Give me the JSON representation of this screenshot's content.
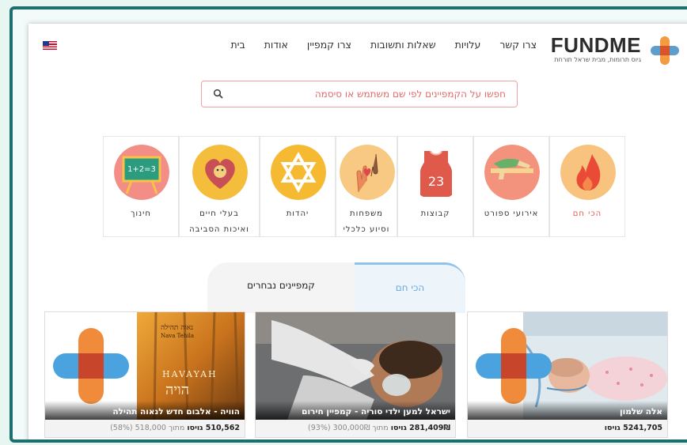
{
  "header": {
    "logo_text": "FUNDME",
    "logo_tagline": "גיוס תרומות, מבית שראל תורחת",
    "nav": [
      "בית",
      "אודות",
      "צרו קמפיין",
      "שאלות ותשובות",
      "עלויות",
      "צרו קשר"
    ],
    "language": "us-flag-icon"
  },
  "search": {
    "placeholder": "חפשו על הקמפיינים לפי שם משתמש או סיסמה"
  },
  "categories": [
    {
      "label": "הכי חם",
      "label2": "",
      "icon": "fire-icon",
      "color": "#f8c37e"
    },
    {
      "label": "אירועי ספורט",
      "label2": "",
      "icon": "hurdle-runner-icon",
      "color": "#f3937d"
    },
    {
      "label": "קבוצות",
      "label2": "",
      "icon": "jersey-23-icon",
      "color": "#ffffff"
    },
    {
      "label": "משפחות",
      "label2": "וסיוע כלכלי",
      "icon": "heart-hands-icon",
      "color": "#f7c983"
    },
    {
      "label": "יהדות",
      "label2": "",
      "icon": "star-of-david-icon",
      "color": "#f5b932"
    },
    {
      "label": "בעלי חיים",
      "label2": "ואיכות הסביבה",
      "icon": "dog-heart-icon",
      "color": "#f5bd3c"
    },
    {
      "label": "חינוך",
      "label2": "",
      "icon": "chalkboard-icon",
      "color": "#f28e86"
    }
  ],
  "tabs": {
    "hot": "הכי חם",
    "selected": "קמפיינים נבחרים"
  },
  "campaigns": [
    {
      "title": "אלה שלמון",
      "raised": "5241,705 גויסו",
      "goal": ""
    },
    {
      "title": "ישראל למען ילדי סוריה - קמפיין חירום",
      "raised": "281,409₪ גויסו",
      "goal": "מתוך 300,000₪ (93%)"
    },
    {
      "title": "הוויה - אלבום חדש לנאוה תהילה",
      "raised": "510,562 גויסו",
      "goal": "מתוך 518,000 (58%)"
    }
  ],
  "album_text": {
    "artist": "נאוה תהילה",
    "artist_en": "Nava Tehila",
    "title_en": "HAVAYAH",
    "title_he": "הויה"
  }
}
